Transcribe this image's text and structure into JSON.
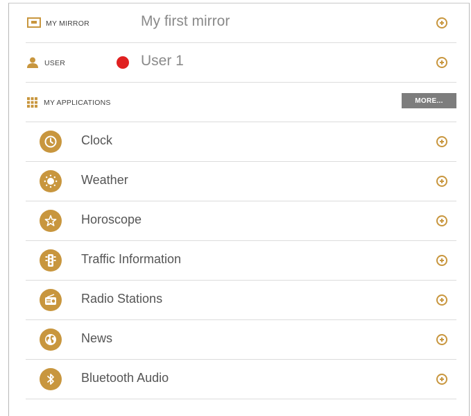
{
  "mirror": {
    "label": "MY MIRROR",
    "name": "My first mirror"
  },
  "user": {
    "label": "USER",
    "name": "User 1",
    "status_color": "#e02020"
  },
  "applications": {
    "label": "MY APPLICATIONS",
    "more_label": "MORE...",
    "items": [
      {
        "label": "Clock",
        "icon": "clock-icon"
      },
      {
        "label": "Weather",
        "icon": "sun-icon"
      },
      {
        "label": "Horoscope",
        "icon": "star-icon"
      },
      {
        "label": "Traffic Information",
        "icon": "traffic-light-icon"
      },
      {
        "label": "Radio Stations",
        "icon": "radio-icon"
      },
      {
        "label": "News",
        "icon": "globe-icon"
      },
      {
        "label": "Bluetooth Audio",
        "icon": "bluetooth-icon"
      }
    ]
  },
  "colors": {
    "accent": "#c8963e",
    "button_bg": "#7d7d7d",
    "divider": "#dcdcdc"
  }
}
